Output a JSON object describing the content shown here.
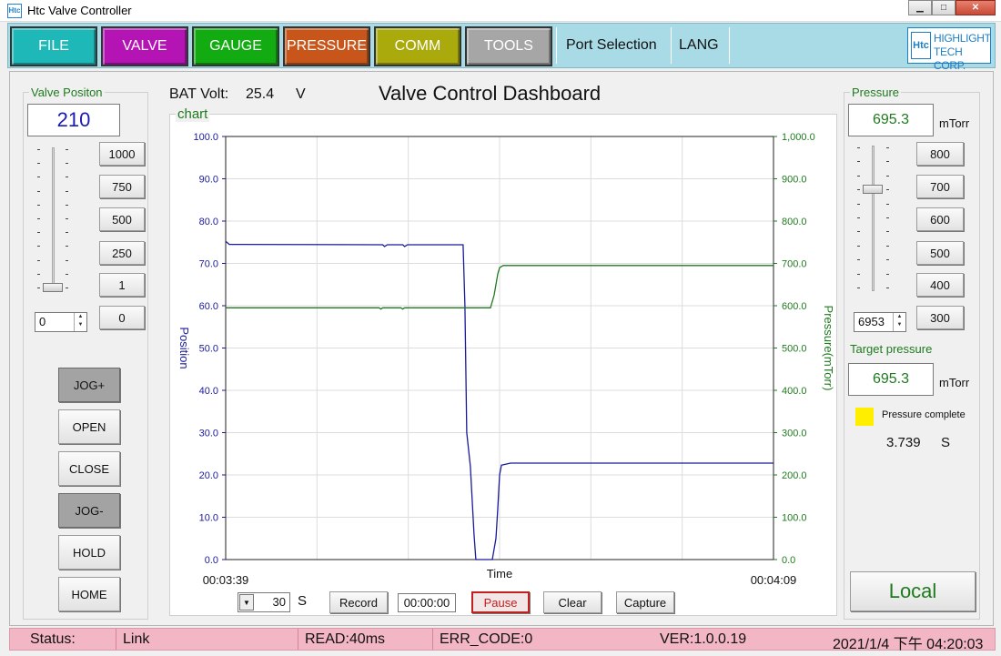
{
  "window": {
    "icon_text": "Htc",
    "title": "Htc Valve Controller",
    "minimize": "▁",
    "maximize": "□",
    "close": "✕"
  },
  "menu": {
    "buttons": [
      {
        "label": "FILE",
        "color": "#1eb8b8"
      },
      {
        "label": "VALVE",
        "color": "#b414b4"
      },
      {
        "label": "GAUGE",
        "color": "#12ac12"
      },
      {
        "label": "PRESSURE",
        "color": "#c8561b"
      },
      {
        "label": "COMM",
        "color": "#aaaa0c"
      },
      {
        "label": "TOOLS",
        "color": "#a6a6a6"
      }
    ],
    "port_selection": "Port Selection",
    "lang": "LANG",
    "logo_mark": "Htc",
    "logo_line1": "HIGHLIGHT",
    "logo_line2": "TECH CORP."
  },
  "valve": {
    "title": "Valve Positon",
    "value": "210",
    "presets": [
      "1000",
      "750",
      "500",
      "250",
      "1",
      "0"
    ],
    "spin_value": "0",
    "slider_level": 0,
    "jog_plus": "JOG+",
    "open": "OPEN",
    "close": "CLOSE",
    "jog_minus": "JOG-",
    "hold": "HOLD",
    "home": "HOME"
  },
  "header": {
    "bat_label": "BAT Volt:",
    "bat_value": "25.4",
    "bat_unit": "V",
    "dashboard_title": "Valve Control Dashboard"
  },
  "chart": {
    "group_title": "chart",
    "controls": {
      "window_value": "30",
      "window_unit": "S",
      "record": "Record",
      "timer": "00:00:00",
      "pause": "Pause",
      "clear": "Clear",
      "capture": "Capture"
    }
  },
  "chart_data": {
    "type": "line",
    "xlabel": "Time",
    "ylabel": "Position",
    "y2label": "Pressure(mTorr)",
    "x_start_label": "00:03:39",
    "x_end_label": "00:04:09",
    "xlim": [
      0,
      30
    ],
    "ylim": [
      0,
      100
    ],
    "y2lim": [
      0,
      1000
    ],
    "y_ticks": [
      "0.0",
      "10.0",
      "20.0",
      "30.0",
      "40.0",
      "50.0",
      "60.0",
      "70.0",
      "80.0",
      "90.0",
      "100.0"
    ],
    "y2_ticks": [
      "0.0",
      "100.0",
      "200.0",
      "300.0",
      "400.0",
      "500.0",
      "600.0",
      "700.0",
      "800.0",
      "900.0",
      "1,000.0"
    ],
    "grid": true,
    "series": [
      {
        "axis": "left",
        "color": "#1a1a9a",
        "points": [
          [
            0,
            75.2
          ],
          [
            0.2,
            74.5
          ],
          [
            8.6,
            74.4
          ],
          [
            8.7,
            74
          ],
          [
            8.85,
            74.4
          ],
          [
            9.7,
            74.4
          ],
          [
            9.8,
            74
          ],
          [
            9.95,
            74.4
          ],
          [
            13.0,
            74.4
          ],
          [
            13.1,
            60
          ],
          [
            13.2,
            30
          ],
          [
            13.4,
            22
          ],
          [
            13.6,
            6
          ],
          [
            13.7,
            0
          ],
          [
            14.6,
            0
          ],
          [
            14.8,
            5
          ],
          [
            14.9,
            12
          ],
          [
            15.0,
            20
          ],
          [
            15.1,
            22.3
          ],
          [
            15.3,
            22.5
          ],
          [
            15.6,
            22.8
          ],
          [
            30,
            22.8
          ]
        ]
      },
      {
        "axis": "right",
        "color": "#1f7a1f",
        "points": [
          [
            0,
            595
          ],
          [
            8.4,
            595
          ],
          [
            8.5,
            592
          ],
          [
            8.6,
            595
          ],
          [
            9.6,
            595
          ],
          [
            9.7,
            592
          ],
          [
            9.8,
            595
          ],
          [
            14.5,
            595
          ],
          [
            14.7,
            625
          ],
          [
            14.8,
            650
          ],
          [
            14.9,
            675
          ],
          [
            15.0,
            690
          ],
          [
            15.2,
            695
          ],
          [
            30,
            695
          ]
        ]
      }
    ]
  },
  "pressure": {
    "title": "Pressure",
    "value": "695.3",
    "unit": "mTorr",
    "presets": [
      "800",
      "700",
      "600",
      "500",
      "400",
      "300"
    ],
    "spin_value": "6953",
    "slider_level": 0.7,
    "target_label": "Target pressure",
    "target_value": "695.3",
    "target_unit": "mTorr",
    "indicator_color": "#ffee00",
    "complete_label": "Pressure complete",
    "complete_time": "3.739",
    "complete_unit": "S",
    "local": "Local"
  },
  "status": {
    "status": "Status:",
    "link": "Link",
    "read": "READ:40ms",
    "err": "ERR_CODE:0",
    "ver": "VER:1.0.0.19",
    "datetime": "2021/1/4 下午 04:20:03"
  }
}
